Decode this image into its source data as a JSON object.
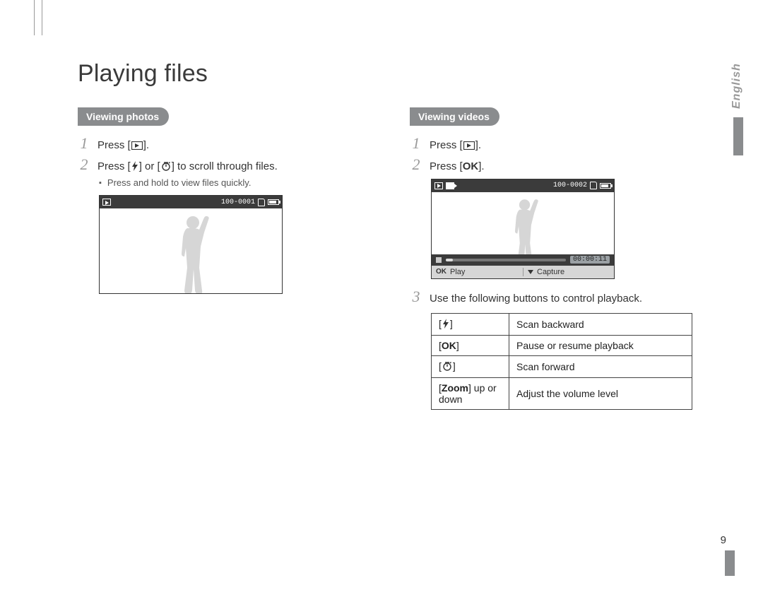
{
  "title": "Playing files",
  "side_language": "English",
  "page_number": "9",
  "left": {
    "section_label": "Viewing photos",
    "steps": {
      "s1": {
        "num": "1",
        "pre": "Press [",
        "post": "]."
      },
      "s2": {
        "num": "2",
        "pre": "Press [",
        "mid": "] or [",
        "post": "] to scroll through files."
      }
    },
    "sub_bullet": "Press and hold to view files quickly.",
    "screen_counter": "100-0001"
  },
  "right": {
    "section_label": "Viewing videos",
    "steps": {
      "s1": {
        "num": "1",
        "pre": "Press [",
        "post": "]."
      },
      "s2": {
        "num": "2",
        "pre": "Press [",
        "ok": "OK",
        "post": "]."
      },
      "s3": {
        "num": "3",
        "text": "Use the following buttons to control playback."
      }
    },
    "screen_counter": "100-0002",
    "timecode": "00:00:11",
    "controls": {
      "play": "Play",
      "capture": "Capture"
    },
    "table": {
      "r1": {
        "desc": "Scan backward"
      },
      "r2": {
        "key": "OK",
        "desc": "Pause or resume playback"
      },
      "r3": {
        "desc": "Scan forward"
      },
      "r4": {
        "key_bold": "Zoom",
        "key_rest": " up or down",
        "desc": "Adjust the volume level"
      }
    }
  }
}
